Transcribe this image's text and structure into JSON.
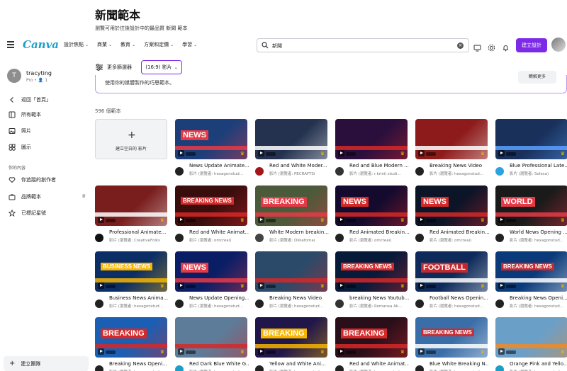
{
  "header": {
    "title": "新聞範本",
    "subtitle": "瀏覽可用於往後設計中的最品質 新聞 範本"
  },
  "navbar": {
    "logo": "Canva",
    "menu": [
      "設計焦點",
      "商業",
      "教育",
      "方案和定價",
      "學習"
    ],
    "search_value": "新聞",
    "create_label": "建立設計"
  },
  "sidebar": {
    "user_initial": "T",
    "username": "tracyting",
    "plan": "Pro • 👤 1",
    "items": [
      {
        "label": "返回「首頁」",
        "icon": "chevron-left-icon"
      },
      {
        "label": "所有範本",
        "icon": "template-icon"
      },
      {
        "label": "照片",
        "icon": "photo-icon"
      },
      {
        "label": "圖示",
        "icon": "elements-icon"
      }
    ],
    "section_label": "你的內容",
    "content_items": [
      {
        "label": "你追蹤的創作者",
        "icon": "heart-pulse-icon"
      },
      {
        "label": "品牌範本",
        "icon": "brand-icon"
      },
      {
        "label": "已標記星號",
        "icon": "star-icon"
      }
    ],
    "new_team_label": "建立團隊"
  },
  "toolbar": {
    "filter_label": "更多篩選器",
    "ratio_label": "(16:9) 影片"
  },
  "tip": {
    "text": "使用你的媒體製作的巧思範本。",
    "button": "瞭解更多"
  },
  "results_count": "596 個範本",
  "blank_card_label": "建立空白的 影片",
  "templates": [
    {
      "name": "News Update Animate...",
      "sub": "影片 (瀏覽者: hexagonstud...",
      "bg": "#1c3f7a",
      "accent": "#e63946",
      "overlay": "NEWS",
      "av": "#222"
    },
    {
      "name": "Red and White Moder...",
      "sub": "影片 (瀏覽者: PECRAFTSi",
      "bg": "#24324f",
      "accent": "#ffffff",
      "overlay": "",
      "av": "#a4161a"
    },
    {
      "name": "Red and Blue Modern ...",
      "sub": "影片 (瀏覽者: r.kristi studi...",
      "bg": "#2a0f3d",
      "accent": "#d62828",
      "overlay": "",
      "av": "#333"
    },
    {
      "name": "Breaking News Video",
      "sub": "影片 (瀏覽者: hexagonstud...",
      "bg": "#8e1b1b",
      "accent": "#ffffff",
      "overlay": "",
      "av": "#222"
    },
    {
      "name": "Blue Professional Late...",
      "sub": "影片 (瀏覽者: Solesa)",
      "bg": "#18305a",
      "accent": "#5aa0ff",
      "overlay": "",
      "av": "#2aa3e0"
    },
    {
      "name": "Professional Animate...",
      "sub": "影片 (瀏覽者: CreativeFolks",
      "bg": "#7a1d1d",
      "accent": "#ffffff",
      "overlay": "",
      "av": "#111"
    },
    {
      "name": "Red and White Animat...",
      "sub": "影片 (瀏覽者: omcreai)",
      "bg": "#3a0d0d",
      "accent": "#d62828",
      "overlay": "BREAKING NEWS",
      "av": "#222"
    },
    {
      "name": "White Modern breakin...",
      "sub": "影片 (瀏覽者: Diikafomai",
      "bg": "#4a5a3a",
      "accent": "#e63946",
      "overlay": "BREAKING",
      "av": "#444"
    },
    {
      "name": "Red Animated Breakin...",
      "sub": "影片 (瀏覽者: omcreai)",
      "bg": "#140a2e",
      "accent": "#d62828",
      "overlay": "NEWS",
      "av": "#222"
    },
    {
      "name": "Red Animated Breakin...",
      "sub": "影片 (瀏覽者: omcreai)",
      "bg": "#0c1428",
      "accent": "#d62828",
      "overlay": "NEWS",
      "av": "#222"
    },
    {
      "name": "World News Opening ...",
      "sub": "影片 (瀏覽者: hexagonstud...",
      "bg": "#1a1a1a",
      "accent": "#e63946",
      "overlay": "WORLD",
      "av": "#222"
    },
    {
      "name": "Business News Anima...",
      "sub": "影片 (瀏覽者: hexagonstud...",
      "bg": "#0b2e66",
      "accent": "#f7b500",
      "overlay": "BUSINESS NEWS",
      "av": "#222"
    },
    {
      "name": "News Update Opening...",
      "sub": "影片 (瀏覽者: hexagonstud...",
      "bg": "#0a1e66",
      "accent": "#e63946",
      "overlay": "NEWS",
      "av": "#222"
    },
    {
      "name": "Breaking News Video",
      "sub": "影片 (瀏覽者: hexagonstud...",
      "bg": "#2b4a6a",
      "accent": "#d62828",
      "overlay": "",
      "av": "#222"
    },
    {
      "name": "breaking News Youtub...",
      "sub": "影片 (瀏覽者: Romansa Ak...",
      "bg": "#061a3a",
      "accent": "#d62828",
      "overlay": "BREAKING NEWS",
      "av": "#333"
    },
    {
      "name": "Football News Openin...",
      "sub": "影片 (瀏覽者: hexagonstud...",
      "bg": "#0d2a5a",
      "accent": "#ffffff",
      "overlay": "FOOTBALL",
      "av": "#222"
    },
    {
      "name": "Breaking News Openi...",
      "sub": "影片 (瀏覽者: hexagonstud...",
      "bg": "#0a3a7a",
      "accent": "#ffffff",
      "overlay": "BREAKING NEWS",
      "av": "#222"
    },
    {
      "name": "Breaking News Openi...",
      "sub": "影片 (瀏覽者: hexagonstud...",
      "bg": "#1a5fb4",
      "accent": "#d62828",
      "overlay": "BREAKING",
      "av": "#222"
    },
    {
      "name": "Red Dark Blue White G...",
      "sub": "影片 (瀏覽者: hexagonstud...",
      "bg": "#5c7c99",
      "accent": "#d62828",
      "overlay": "",
      "av": "#1aa0c8"
    },
    {
      "name": "Yellow and White Ani...",
      "sub": "影片 (瀏覽者: hexagonstud...",
      "bg": "#20164a",
      "accent": "#f7b500",
      "overlay": "BREAKING",
      "av": "#222"
    },
    {
      "name": "Red and White Animat...",
      "sub": "影片 (瀏覽者: hexagonstud...",
      "bg": "#2a0f1a",
      "accent": "#d62828",
      "overlay": "BREAKING",
      "av": "#222"
    },
    {
      "name": "Blue White Breaking N...",
      "sub": "影片 (瀏覽者: hexagonstud...",
      "bg": "#3a6ea8",
      "accent": "#ffffff",
      "overlay": "BREAKING NEWS",
      "av": "#222"
    },
    {
      "name": "Orange Pink and Yello...",
      "sub": "影片 (瀏覽者: hexagonstud...",
      "bg": "#6a9fc8",
      "accent": "#f08a24",
      "overlay": "",
      "av": "#1aa0c8"
    }
  ],
  "colors": {
    "accent": "#7d2ae8",
    "logo": "#1aa0c8"
  }
}
